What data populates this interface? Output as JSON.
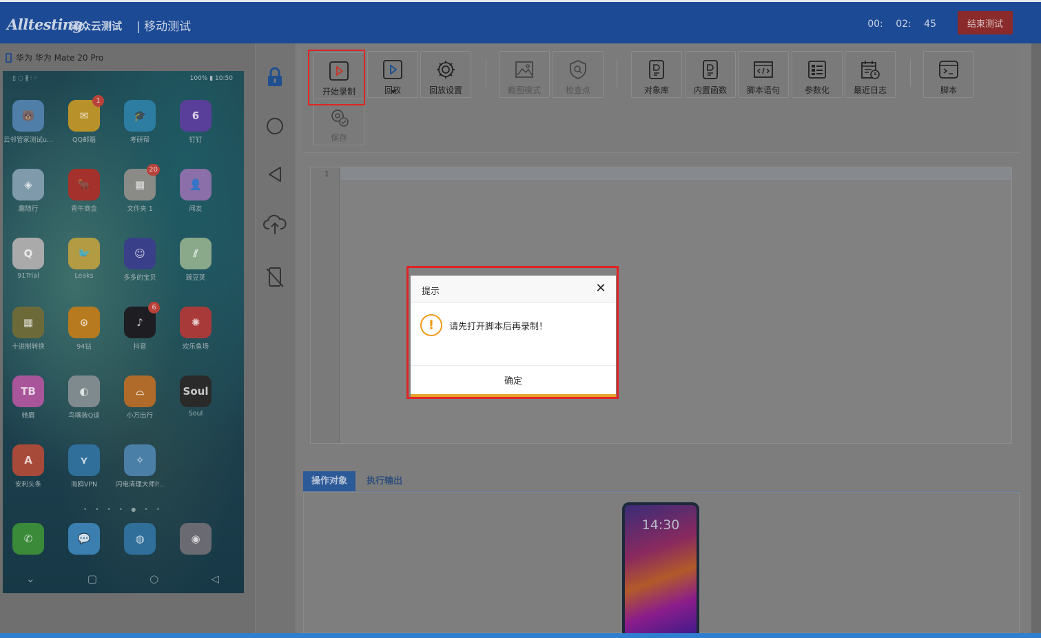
{
  "header": {
    "logo": "Alltesting",
    "logo_cn": "泽众云测试",
    "section": "| 移动测试",
    "timer": "00: 02: 45",
    "end_button": "结束测试"
  },
  "device": {
    "label": "华为 华为 Mate 20 Pro",
    "status_left": "▯ ◌ ∦ ⫶ ◦",
    "status_right": "100% ▮ 10:50",
    "apps": [
      {
        "label": "云邻管家测试u...",
        "icon": "bear-icon",
        "color": "#4f7fa8",
        "glyph": "🐻"
      },
      {
        "label": "QQ邮箱",
        "icon": "mail-icon",
        "color": "#b9912a",
        "glyph": "✉",
        "badge": "1"
      },
      {
        "label": "考研帮",
        "icon": "graduation-icon",
        "color": "#2d7da3",
        "glyph": "🎓"
      },
      {
        "label": "钉钉",
        "icon": "six-icon",
        "color": "#5a3f9a",
        "glyph": "6"
      },
      {
        "label": "趣随行",
        "icon": "diamond-icon",
        "color": "#7f9aaa",
        "glyph": "◈"
      },
      {
        "label": "青牛商金",
        "icon": "bull-icon",
        "color": "#a5312c",
        "glyph": "🐂"
      },
      {
        "label": "文件夹 1",
        "icon": "folder-icon",
        "color": "#8a8a86",
        "glyph": "▦",
        "badge": "20"
      },
      {
        "label": "闻友",
        "icon": "profile-icon",
        "color": "#8a6fa8",
        "glyph": "👤"
      },
      {
        "label": "91Trial",
        "icon": "trial-icon",
        "color": "#aaaaaa",
        "glyph": "Q"
      },
      {
        "label": "Leaks",
        "icon": "bird-icon",
        "color": "#b29b42",
        "glyph": "🐦"
      },
      {
        "label": "多多的宝贝",
        "icon": "kid-icon",
        "color": "#3a3f8a",
        "glyph": "☺"
      },
      {
        "label": "豌豆荚",
        "icon": "pea-icon",
        "color": "#8aa88a",
        "glyph": "⫽"
      },
      {
        "label": "十进制转换",
        "icon": "calculator-icon",
        "color": "#6d6a3a",
        "glyph": "▦"
      },
      {
        "label": "94钻",
        "icon": "tape-icon",
        "color": "#b77a1e",
        "glyph": "⊙"
      },
      {
        "label": "抖音",
        "icon": "tiktok-icon",
        "color": "#1d1d22",
        "glyph": "♪",
        "badge": "6"
      },
      {
        "label": "欢乐鱼场",
        "icon": "wheel-icon",
        "color": "#a83a3a",
        "glyph": "✺"
      },
      {
        "label": "她眉",
        "icon": "tb-icon",
        "color": "#a8559a",
        "glyph": "TB"
      },
      {
        "label": "鸟嘴装Q谈",
        "icon": "shield-q-icon",
        "color": "#7f8a8f",
        "glyph": "◐"
      },
      {
        "label": "小万出行",
        "icon": "car-icon",
        "color": "#b06a2a",
        "glyph": "⌓"
      },
      {
        "label": "Soul",
        "icon": "soul-icon",
        "color": "#2a2a2a",
        "glyph": "Soul"
      },
      {
        "label": "安利头条",
        "icon": "letter-a-icon",
        "color": "#a84a3a",
        "glyph": "A"
      },
      {
        "label": "海鸥VPN",
        "icon": "gull-icon",
        "color": "#2f6f9a",
        "glyph": "⋎"
      },
      {
        "label": "闪电清理大师P...",
        "icon": "broom-icon",
        "color": "#4a7fa8",
        "glyph": "✧"
      }
    ],
    "dock": [
      {
        "label": "",
        "icon": "phone-call-icon",
        "color": "#3a8a3a",
        "glyph": "✆"
      },
      {
        "label": "",
        "icon": "message-icon",
        "color": "#3a7fb0",
        "glyph": "💬"
      },
      {
        "label": "",
        "icon": "browser-icon",
        "color": "#2f6f9a",
        "glyph": "◍"
      },
      {
        "label": "",
        "icon": "camera-icon",
        "color": "#6a6a72",
        "glyph": "◉"
      }
    ],
    "page_dots": "• • • • ● • •",
    "nav": [
      "⌄",
      "▢",
      "○",
      "◁"
    ]
  },
  "toolbar": {
    "tools": [
      {
        "name": "start-record",
        "label": "开始录制",
        "icon": "record-icon"
      },
      {
        "name": "playback",
        "label": "回放",
        "icon": "play-icon"
      },
      {
        "name": "playback-settings",
        "label": "回放设置",
        "icon": "gear-icon"
      },
      {
        "name": "screenshot-mode",
        "label": "截图模式",
        "icon": "image-icon"
      },
      {
        "name": "checkpoint",
        "label": "检查点",
        "icon": "shield-search-icon"
      },
      {
        "name": "object-library",
        "label": "对象库",
        "icon": "doc-d-icon"
      },
      {
        "name": "builtin-functions",
        "label": "内置函数",
        "icon": "doc-d-icon"
      },
      {
        "name": "script-statements",
        "label": "脚本语句",
        "icon": "code-window-icon"
      },
      {
        "name": "parameterize",
        "label": "参数化",
        "icon": "list-icon"
      },
      {
        "name": "recent-logs",
        "label": "最近日志",
        "icon": "calendar-clock-icon"
      },
      {
        "name": "script",
        "label": "脚本",
        "icon": "terminal-icon"
      },
      {
        "name": "save",
        "label": "保存",
        "icon": "gear-check-icon"
      }
    ]
  },
  "editor": {
    "line_number": "1"
  },
  "tabs": {
    "active": "操作对象",
    "inactive": "执行输出"
  },
  "preview": {
    "time": "14:30"
  },
  "dialog": {
    "title": "提示",
    "close": "✕",
    "icon": "!",
    "message": "请先打开脚本后再录制！",
    "ok": "确定"
  },
  "colors": {
    "header": "#1c4a95",
    "end_button": "#c0392b",
    "highlight": "#e02424",
    "warning": "#ef9b18",
    "tab_active": "#2c5a99"
  }
}
